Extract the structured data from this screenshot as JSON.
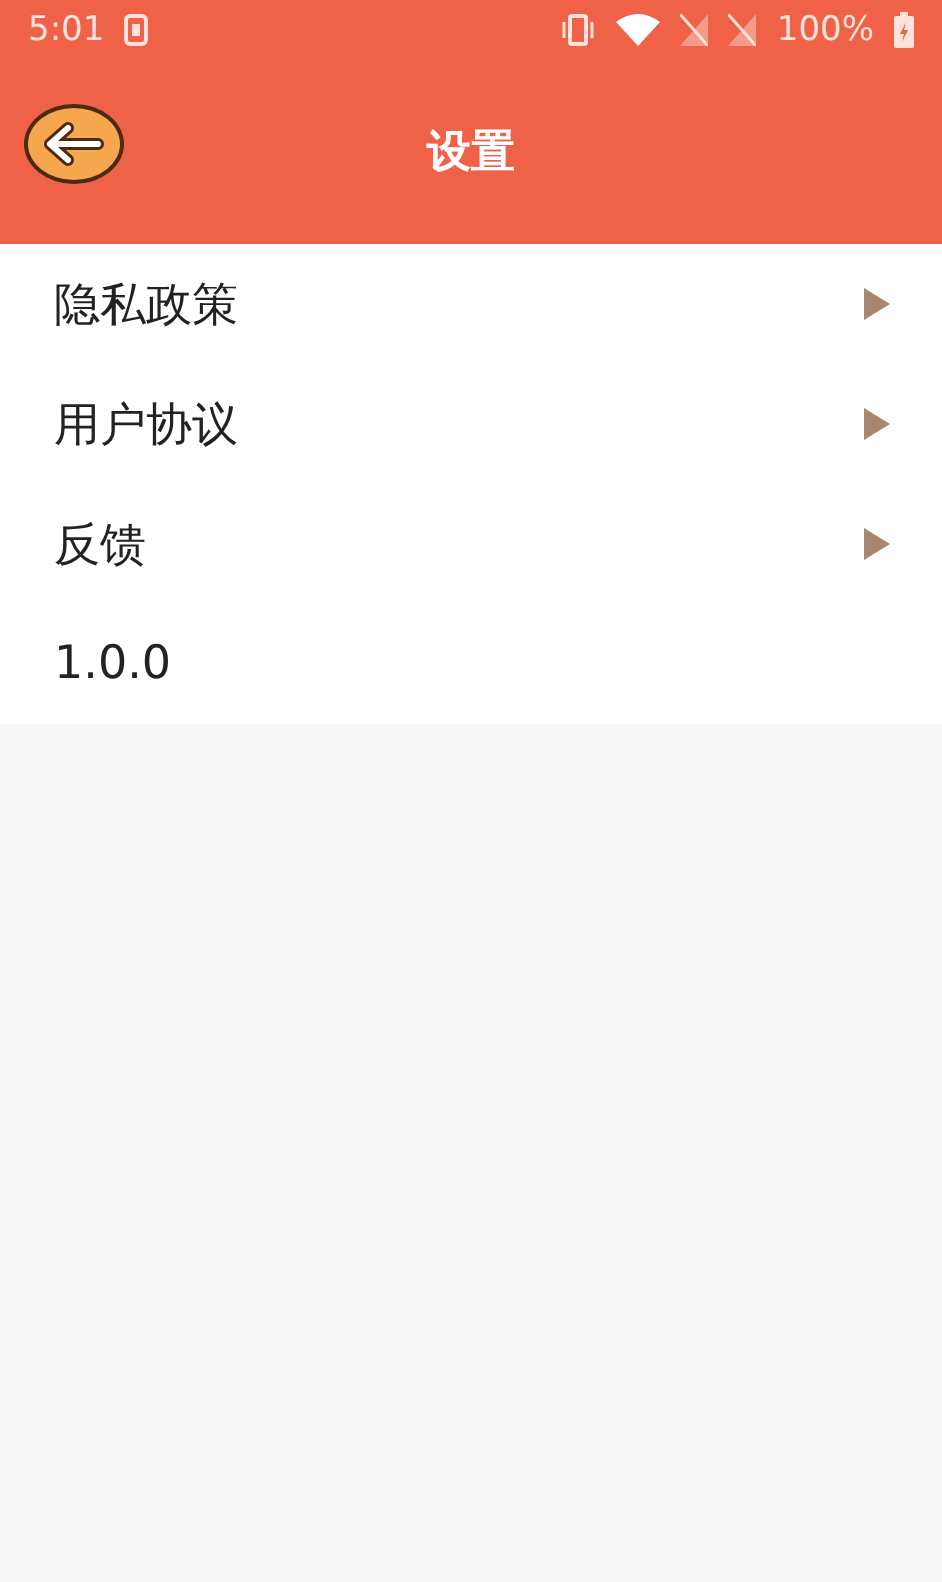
{
  "status_bar": {
    "time": "5:01",
    "battery": "100%"
  },
  "header": {
    "title": "设置"
  },
  "items": [
    {
      "label": "隐私政策",
      "kind": "link"
    },
    {
      "label": "用户协议",
      "kind": "link"
    },
    {
      "label": "反馈",
      "kind": "link"
    },
    {
      "label": "1.0.0",
      "kind": "version"
    }
  ]
}
